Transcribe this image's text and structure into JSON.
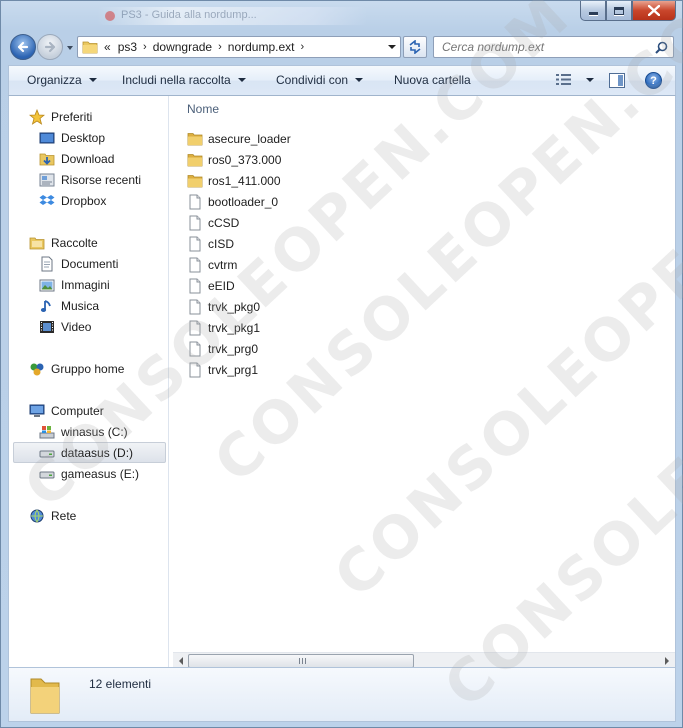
{
  "titlebar": {
    "tab_text": "PS3 - Guida alla nordump..."
  },
  "address": {
    "overflow_marker": "«",
    "crumbs": [
      "ps3",
      "downgrade",
      "nordump.ext"
    ]
  },
  "search": {
    "placeholder": "Cerca nordump.ext"
  },
  "command_bar": {
    "organize": "Organizza",
    "include": "Includi nella raccolta",
    "share": "Condividi con",
    "new_folder": "Nuova cartella",
    "help": "?"
  },
  "nav_pane": {
    "favorites": {
      "label": "Preferiti",
      "items": [
        "Desktop",
        "Download",
        "Risorse recenti",
        "Dropbox"
      ]
    },
    "libraries": {
      "label": "Raccolte",
      "items": [
        "Documenti",
        "Immagini",
        "Musica",
        "Video"
      ]
    },
    "homegroup": "Gruppo home",
    "computer": {
      "label": "Computer",
      "items": [
        "winasus (C:)",
        "dataasus (D:)",
        "gameasus (E:)"
      ],
      "selected": "dataasus (D:)"
    },
    "network": "Rete"
  },
  "file_list": {
    "column_name": "Nome",
    "items": [
      {
        "name": "asecure_loader",
        "type": "folder"
      },
      {
        "name": "ros0_373.000",
        "type": "folder"
      },
      {
        "name": "ros1_411.000",
        "type": "folder"
      },
      {
        "name": "bootloader_0",
        "type": "file"
      },
      {
        "name": "cCSD",
        "type": "file"
      },
      {
        "name": "cISD",
        "type": "file"
      },
      {
        "name": "cvtrm",
        "type": "file"
      },
      {
        "name": "eEID",
        "type": "file"
      },
      {
        "name": "trvk_pkg0",
        "type": "file"
      },
      {
        "name": "trvk_pkg1",
        "type": "file"
      },
      {
        "name": "trvk_prg0",
        "type": "file"
      },
      {
        "name": "trvk_prg1",
        "type": "file"
      }
    ]
  },
  "details": {
    "count": "12 elementi"
  },
  "watermark": "CONSOLEOPEN.COM",
  "colors": {
    "frame": "#bcd2ea",
    "folder": "#e9c760",
    "accent": "#2b63b2"
  }
}
